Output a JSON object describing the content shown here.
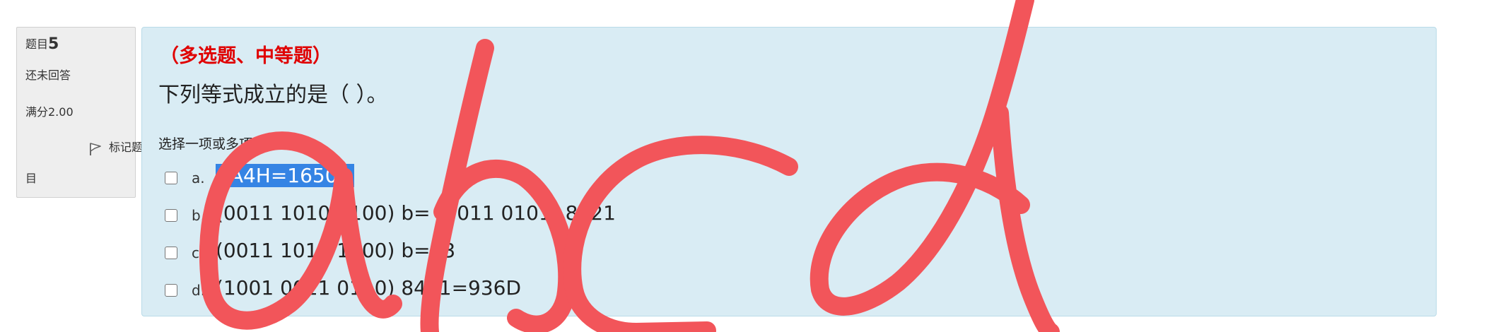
{
  "info": {
    "question_label": "题目",
    "question_number": "5",
    "state": "还未回答",
    "grade": "满分2.00",
    "flag_label_line1": "标记题",
    "flag_label_line2": "目"
  },
  "question": {
    "type": "（多选题、中等题）",
    "text": "下列等式成立的是（ ）。",
    "prompt": "选择一项或多项："
  },
  "options": [
    {
      "letter": "a.",
      "text": "3A4H=1650D",
      "selected_text": true
    },
    {
      "letter": "b.",
      "text": "(0011 1010 0100) b= (0011 0101) 8421"
    },
    {
      "letter": "c.",
      "text": "(0011 1010 1000) b=93"
    },
    {
      "letter": "d.",
      "text": "(1001 0011 0110) 8421=936D"
    }
  ],
  "annotation": {
    "handwriting": "abcd",
    "color": "#f2555a"
  }
}
